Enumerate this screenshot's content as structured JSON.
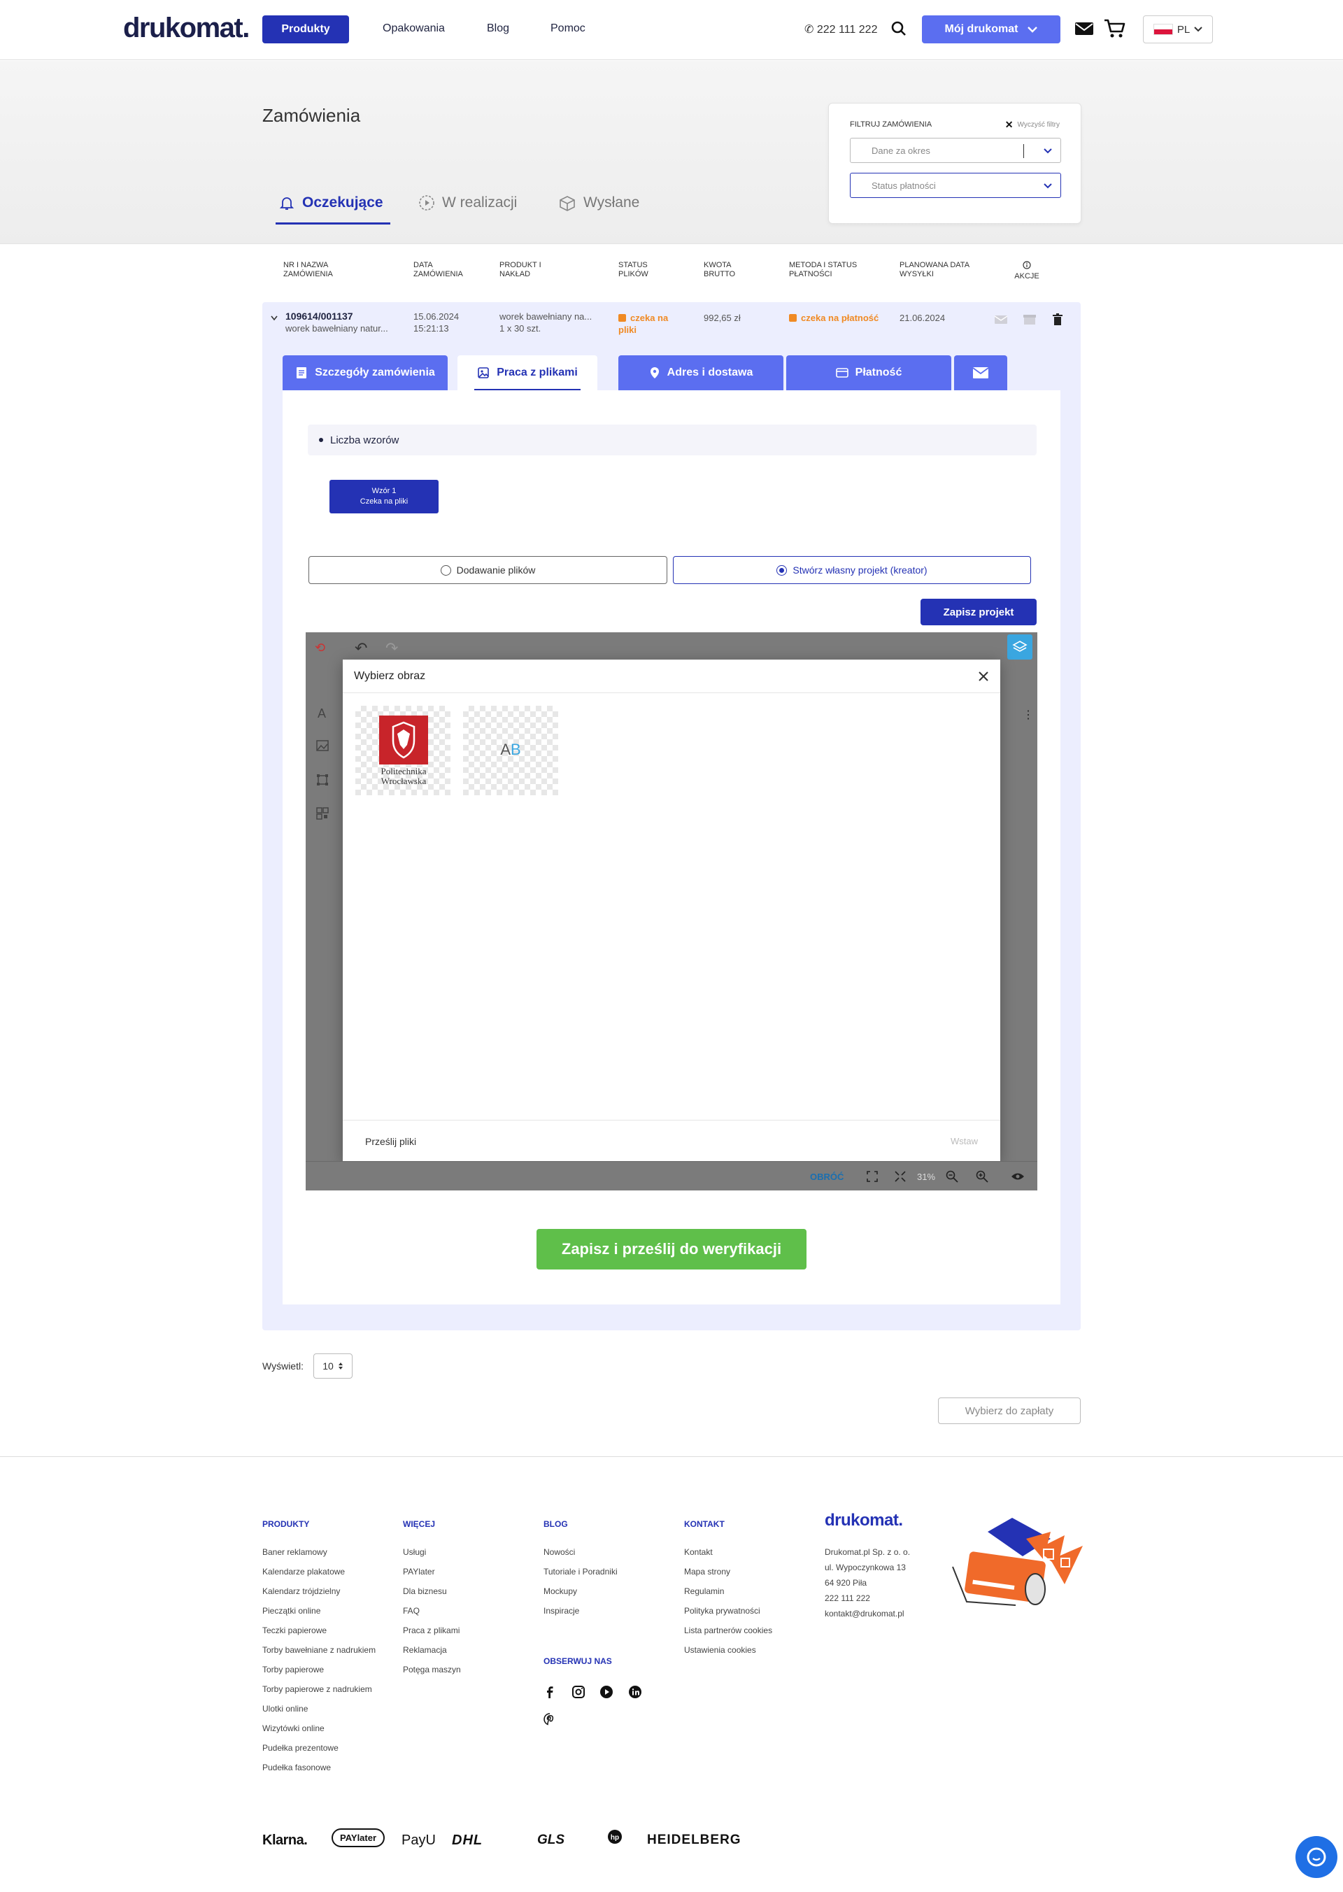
{
  "header": {
    "logo": "drukomat.",
    "nav": {
      "products": "Produkty",
      "packaging": "Opakowania",
      "blog": "Blog",
      "help": "Pomoc"
    },
    "phone": "222 111 222",
    "my_account": "Mój drukomat",
    "language": "PL"
  },
  "page": {
    "title": "Zamówienia",
    "tabs": [
      {
        "label": "Oczekujące"
      },
      {
        "label": "W realizacji"
      },
      {
        "label": "Wysłane"
      }
    ]
  },
  "filter": {
    "label": "FILTRUJ ZAMÓWIENIA",
    "clear": "Wyczyść filtry",
    "period_placeholder": "Dane za okres",
    "payment_status_placeholder": "Status płatności"
  },
  "table": {
    "headers": [
      "NR I NAZWA ZAMÓWIENIA",
      "DATA ZAMÓWIENIA",
      "PRODUKT I NAKŁAD",
      "STATUS PLIKÓW",
      "KWOTA BRUTTO",
      "METODA I STATUS PŁATNOŚCI",
      "PLANOWANA DATA WYSYŁKI",
      "AKCJE"
    ]
  },
  "order": {
    "number": "109614/001137",
    "name": "worek bawełniany natur...",
    "date": "15.06.2024",
    "time": "15:21:13",
    "product": "worek bawełniany na...",
    "quantity": "1 x 30 szt.",
    "file_status": "czeka na pliki",
    "amount": "992,65 zł",
    "payment_status": "czeka na płatność",
    "shipping_date": "21.06.2024"
  },
  "detail_tabs": {
    "details": "Szczegóły zamówienia",
    "files": "Praca z plikami",
    "address": "Adres i dostawa",
    "payment": "Płatność"
  },
  "files": {
    "count_label": "Liczba wzorów",
    "design_name": "Wzór 1",
    "design_status": "Czeka na pliki",
    "option_upload": "Dodawanie plików",
    "option_creator": "Stwórz własny projekt (kreator)",
    "save_project": "Zapisz projekt"
  },
  "editor": {
    "modal_title": "Wybierz obraz",
    "logo_text_1": "Politechnika",
    "logo_text_2": "Wrocławska",
    "text_thumb_a": "A",
    "text_thumb_b": "B",
    "upload": "Prześlij pliki",
    "insert": "Wstaw",
    "rotate": "OBRÓĆ",
    "zoom": "31%"
  },
  "submit_label": "Zapisz i prześlij do weryfikacji",
  "pagination": {
    "show_label": "Wyświetl:",
    "per_page": "10"
  },
  "pay_selected": "Wybierz do zapłaty",
  "footer": {
    "columns": [
      {
        "title": "PRODUKTY",
        "links": [
          "Baner reklamowy",
          "Kalendarze plakatowe",
          "Kalendarz trójdzielny",
          "Pieczątki online",
          "Teczki papierowe",
          "Torby bawełniane z nadrukiem",
          "Torby papierowe",
          "Torby papierowe z nadrukiem",
          "Ulotki online",
          "Wizytówki online",
          "Pudełka prezentowe",
          "Pudełka fasonowe"
        ]
      },
      {
        "title": "WIĘCEJ",
        "links": [
          "Usługi",
          "PAYlater",
          "Dla biznesu",
          "FAQ",
          "Praca z plikami",
          "Reklamacja",
          "Potęga maszyn"
        ]
      },
      {
        "title": "BLOG",
        "links": [
          "Nowości",
          "Tutoriale i Poradniki",
          "Mockupy",
          "Inspiracje"
        ]
      },
      {
        "title": "KONTAKT",
        "links": [
          "Kontakt",
          "Mapa strony",
          "Regulamin",
          "Polityka prywatności",
          "Lista partnerów cookies",
          "Ustawienia cookies"
        ]
      }
    ],
    "follow": "OBSERWUJ NAS",
    "company": {
      "logo": "drukomat.",
      "lines": [
        "Drukomat.pl Sp. z o. o.",
        "ul. Wypoczynkowa 13",
        "64 920 Piła",
        "222 111 222",
        "kontakt@drukomat.pl"
      ]
    },
    "payments": [
      "Klarna.",
      "PAYlater",
      "PayU",
      "DHL",
      "GLS",
      "HEIDELBERG"
    ]
  },
  "colors": {
    "primary": "#2432b4",
    "accent": "#5b6ef0",
    "warning": "#f08a24",
    "success": "#5fbf4a"
  }
}
